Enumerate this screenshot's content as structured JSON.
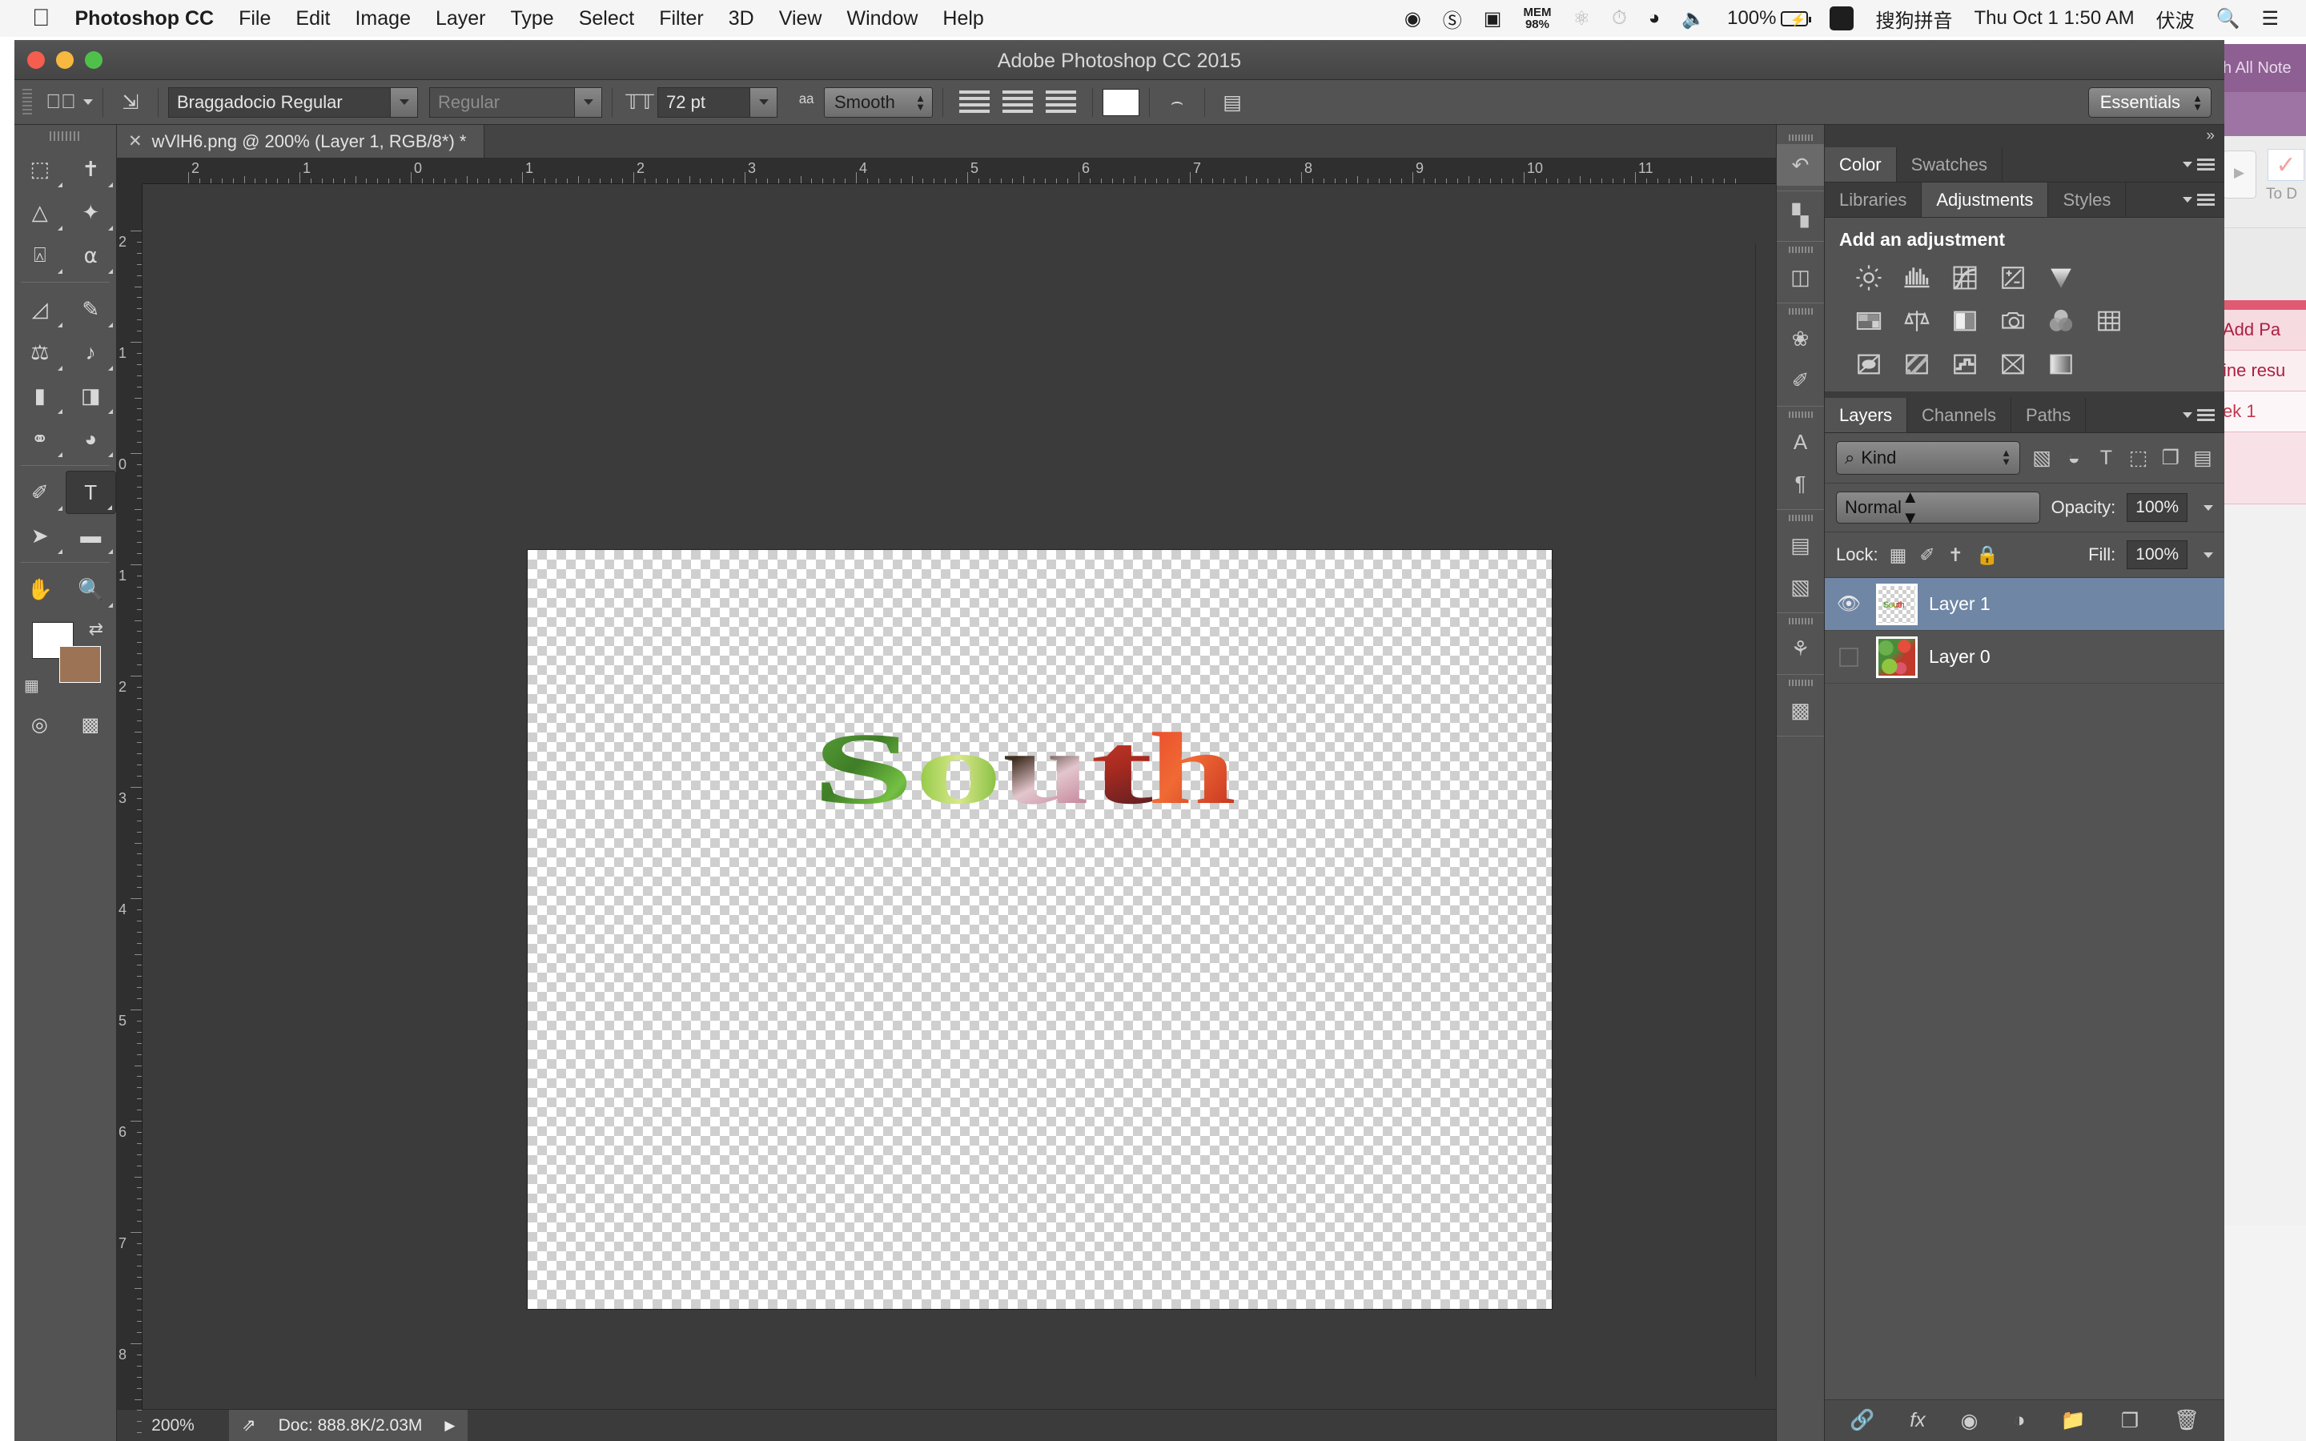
{
  "menubar": {
    "apple_icon": "apple-icon",
    "items": [
      {
        "label": "Photoshop CC",
        "bold": true
      },
      {
        "label": "File",
        "bold": false
      },
      {
        "label": "Edit",
        "bold": false
      },
      {
        "label": "Image",
        "bold": false
      },
      {
        "label": "Layer",
        "bold": false
      },
      {
        "label": "Type",
        "bold": false
      },
      {
        "label": "Select",
        "bold": false
      },
      {
        "label": "Filter",
        "bold": false
      },
      {
        "label": "3D",
        "bold": false
      },
      {
        "label": "View",
        "bold": false
      },
      {
        "label": "Window",
        "bold": false
      },
      {
        "label": "Help",
        "bold": false
      }
    ],
    "status": {
      "wechat_icon": "wechat-icon",
      "creative_cloud_icon": "creative-cloud-icon",
      "bookmark_icon": "bookmark-icon",
      "mem_label": "MEM",
      "mem_value": "98%",
      "bluetooth_icon": "bluetooth-icon",
      "timemachine_icon": "time-machine-icon",
      "wifi_icon": "wifi-icon",
      "volume_icon": "volume-icon",
      "battery_percent": "100%",
      "battery_icon": "battery-charging-icon",
      "input_badge": "S",
      "input_method": "搜狗拼音",
      "clock": "Thu Oct 1  1:50 AM",
      "user": "伏波",
      "search_icon": "search-icon",
      "notification_icon": "notification-center-icon"
    }
  },
  "window": {
    "title": "Adobe Photoshop CC 2015"
  },
  "options_bar": {
    "tool_icon": "type-tool-icon",
    "orientation_icon": "text-orientation-icon",
    "font_family": "Braggadocio Regular",
    "font_style": "Regular",
    "size_icon": "font-size-icon",
    "font_size": "72 pt",
    "antialias_icon": "anti-aliasing-icon",
    "antialias": "Smooth",
    "align_left_icon": "align-left-icon",
    "align_center_icon": "align-center-icon",
    "align_right_icon": "align-right-icon",
    "color_swatch": "#ffffff",
    "warp_icon": "warp-text-icon",
    "char_panel_icon": "character-paragraph-panel-icon",
    "workspace": "Essentials"
  },
  "toolbar": {
    "tools": [
      {
        "name": "marquee-tool",
        "glyph": "▭"
      },
      {
        "name": "move-tool",
        "glyph": "✥"
      },
      {
        "name": "lasso-tool",
        "glyph": "ᗐ"
      },
      {
        "name": "magic-wand-tool",
        "glyph": "✦"
      },
      {
        "name": "crop-tool",
        "glyph": "⌗"
      },
      {
        "name": "eyedropper-tool",
        "glyph": "✒"
      },
      {
        "name": "healing-brush-tool",
        "glyph": "⊘"
      },
      {
        "name": "brush-tool",
        "glyph": "✎"
      },
      {
        "name": "clone-stamp-tool",
        "glyph": "⌶"
      },
      {
        "name": "history-brush-tool",
        "glyph": "♒"
      },
      {
        "name": "eraser-tool",
        "glyph": "▰"
      },
      {
        "name": "gradient-tool",
        "glyph": "◨"
      },
      {
        "name": "blur-tool",
        "glyph": "◍"
      },
      {
        "name": "dodge-tool",
        "glyph": "◑"
      },
      {
        "name": "pen-tool",
        "glyph": "✑"
      },
      {
        "name": "type-tool",
        "glyph": "T",
        "selected": true
      },
      {
        "name": "path-selection-tool",
        "glyph": "➤"
      },
      {
        "name": "rectangle-tool",
        "glyph": "▬"
      },
      {
        "name": "hand-tool",
        "glyph": "✋"
      },
      {
        "name": "zoom-tool",
        "glyph": "⌕"
      }
    ],
    "foreground_color": "#ffffff",
    "background_color": "#9c7354",
    "swap_icon": "swap-colors-icon",
    "default_colors_icon": "default-colors-icon",
    "quick_mask_icon": "quick-mask-icon",
    "screen_mode_icon": "screen-mode-icon"
  },
  "document": {
    "tab_title": "wVlH6.png @ 200% (Layer 1, RGB/8*) *",
    "close_icon": "close-icon",
    "ruler_h": [
      "2",
      "1",
      "0",
      "1",
      "2",
      "3",
      "4",
      "5",
      "6",
      "7",
      "8",
      "9",
      "10",
      "11"
    ],
    "ruler_v": [
      "2",
      "1",
      "0",
      "1",
      "2",
      "3",
      "4",
      "5",
      "6",
      "7",
      "8"
    ],
    "artwork_text": "South",
    "status": {
      "zoom": "200%",
      "share_icon": "share-icon",
      "doc_size": "Doc: 888.8K/2.03M",
      "expand_icon": "expand-arrow-icon"
    }
  },
  "dock": {
    "icons": [
      {
        "name": "history-panel-icon",
        "glyph": "↺",
        "active": true
      },
      {
        "name": "histogram-panel-icon",
        "glyph": "▥"
      },
      {
        "name": "3d-panel-icon",
        "glyph": "◰"
      },
      {
        "name": "brush-presets-panel-icon",
        "glyph": "✿"
      },
      {
        "name": "brush-panel-icon",
        "glyph": "✐"
      },
      {
        "name": "character-panel-icon",
        "glyph": "A"
      },
      {
        "name": "paragraph-panel-icon",
        "glyph": "¶"
      },
      {
        "name": "properties-panel-icon",
        "glyph": "▤"
      },
      {
        "name": "notes-panel-icon",
        "glyph": "▣"
      },
      {
        "name": "paths-panel-icon",
        "glyph": "✎"
      },
      {
        "name": "timeline-panel-icon",
        "glyph": "◩"
      }
    ]
  },
  "panels": {
    "collapse_icon": "collapse-panels-icon",
    "color_group": {
      "tabs": [
        {
          "label": "Color",
          "active": true
        },
        {
          "label": "Swatches",
          "active": false
        }
      ],
      "menu_icon": "panel-menu-icon"
    },
    "adjustments_group": {
      "tabs": [
        {
          "label": "Libraries",
          "active": false
        },
        {
          "label": "Adjustments",
          "active": true
        },
        {
          "label": "Styles",
          "active": false
        }
      ],
      "menu_icon": "panel-menu-icon",
      "title": "Add an adjustment",
      "rows": [
        [
          {
            "name": "brightness-contrast-adjustment-icon",
            "glyph": "☀"
          },
          {
            "name": "levels-adjustment-icon",
            "glyph": "▥"
          },
          {
            "name": "curves-adjustment-icon",
            "glyph": "∫"
          },
          {
            "name": "exposure-adjustment-icon",
            "glyph": "±"
          },
          {
            "name": "vibrance-adjustment-icon",
            "glyph": "▼"
          }
        ],
        [
          {
            "name": "hue-saturation-adjustment-icon",
            "glyph": "▤"
          },
          {
            "name": "color-balance-adjustment-icon",
            "glyph": "⚖"
          },
          {
            "name": "black-white-adjustment-icon",
            "glyph": "◧"
          },
          {
            "name": "photo-filter-adjustment-icon",
            "glyph": "⌾"
          },
          {
            "name": "channel-mixer-adjustment-icon",
            "glyph": "◉"
          },
          {
            "name": "color-lookup-adjustment-icon",
            "glyph": "▦"
          }
        ],
        [
          {
            "name": "invert-adjustment-icon",
            "glyph": "⊘"
          },
          {
            "name": "posterize-adjustment-icon",
            "glyph": "▧"
          },
          {
            "name": "threshold-adjustment-icon",
            "glyph": "▨"
          },
          {
            "name": "selective-color-adjustment-icon",
            "glyph": "⋈"
          },
          {
            "name": "gradient-map-adjustment-icon",
            "glyph": "▪"
          }
        ]
      ]
    },
    "layers_group": {
      "tabs": [
        {
          "label": "Layers",
          "active": true
        },
        {
          "label": "Channels",
          "active": false
        },
        {
          "label": "Paths",
          "active": false
        }
      ],
      "menu_icon": "panel-menu-icon",
      "filter_label": "Kind",
      "filter_search_icon": "search-icon",
      "filter_icons": [
        {
          "name": "filter-pixel-layers-icon",
          "glyph": "🖼"
        },
        {
          "name": "filter-adjustment-layers-icon",
          "glyph": "◍"
        },
        {
          "name": "filter-type-layers-icon",
          "glyph": "T"
        },
        {
          "name": "filter-shape-layers-icon",
          "glyph": "⬚"
        },
        {
          "name": "filter-smart-objects-icon",
          "glyph": "❐"
        }
      ],
      "filter_toggle_icon": "filter-toggle-icon",
      "blend_mode": "Normal",
      "opacity_label": "Opacity:",
      "opacity_value": "100%",
      "lock_label": "Lock:",
      "lock_icons": [
        {
          "name": "lock-transparent-pixels-icon",
          "glyph": "▩"
        },
        {
          "name": "lock-image-pixels-icon",
          "glyph": "✎"
        },
        {
          "name": "lock-position-icon",
          "glyph": "✥"
        },
        {
          "name": "lock-all-icon",
          "glyph": "🔒"
        }
      ],
      "fill_label": "Fill:",
      "fill_value": "100%",
      "layers": [
        {
          "name": "Layer 1",
          "visible": true,
          "selected": true,
          "thumb": "transparent-text-thumbnail",
          "thumb_text": "South"
        },
        {
          "name": "Layer 0",
          "visible": false,
          "selected": false,
          "thumb": "vegetables-photo-thumbnail",
          "thumb_text": ""
        }
      ],
      "bottom_icons": [
        {
          "name": "link-layers-icon",
          "glyph": "🔗"
        },
        {
          "name": "layer-style-fx-icon",
          "glyph": "fx"
        },
        {
          "name": "add-layer-mask-icon",
          "glyph": "◉"
        },
        {
          "name": "new-adjustment-layer-icon",
          "glyph": "◍"
        },
        {
          "name": "new-group-icon",
          "glyph": "🗀"
        },
        {
          "name": "new-layer-icon",
          "glyph": "❐"
        },
        {
          "name": "delete-layer-icon",
          "glyph": "🗑"
        }
      ]
    }
  },
  "background_app": {
    "header": "h All Note",
    "play_icon": "play-icon",
    "check_icon": "check-icon",
    "to_do_label": "To D",
    "rows": [
      "Add Pa",
      "ine resu",
      "ek 1"
    ]
  }
}
